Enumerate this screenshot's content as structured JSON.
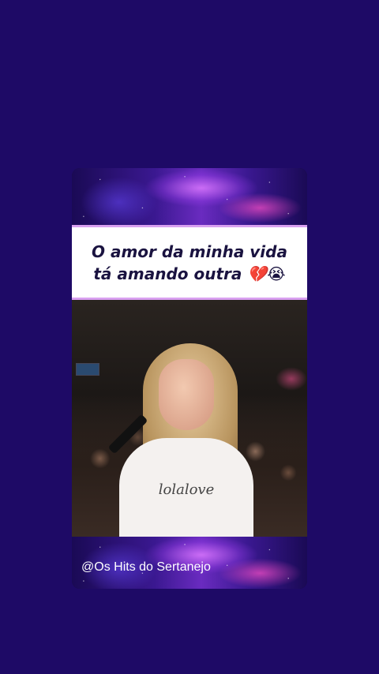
{
  "caption": {
    "line1": "O amor da minha vida",
    "line2": "tá amando outra 💔😭"
  },
  "video": {
    "shirt_text": "lolalove"
  },
  "watermark": "@Os Hits do Sertanejo",
  "colors": {
    "background": "#1e0a66",
    "caption_border": "#d9a0f0",
    "caption_text": "#1a1340"
  }
}
